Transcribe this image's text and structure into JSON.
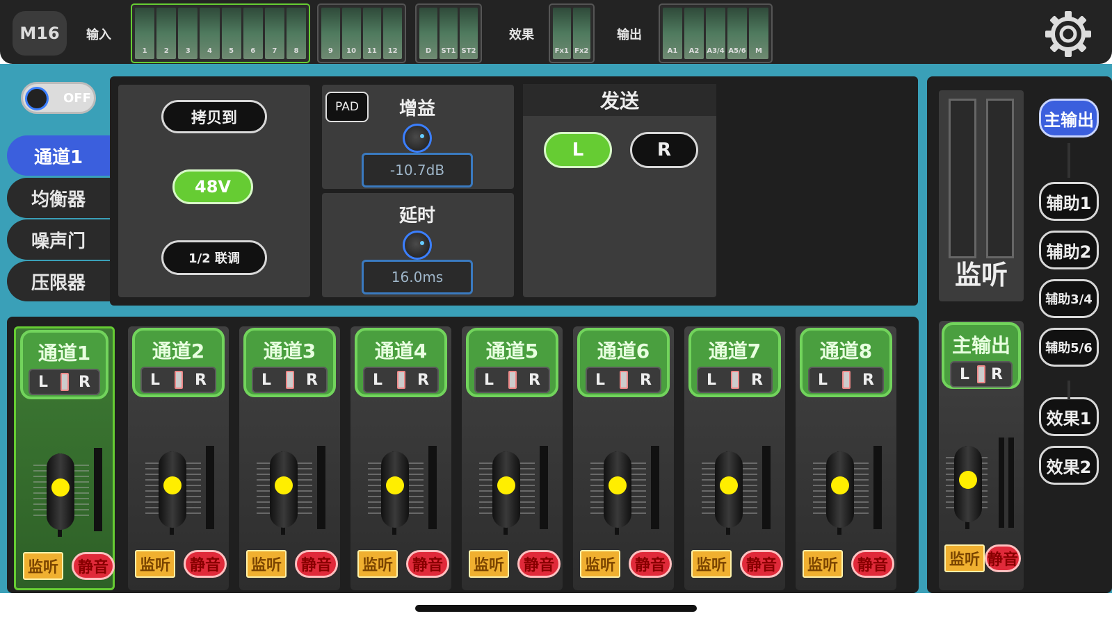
{
  "app": {
    "logo": "M16"
  },
  "topbar": {
    "input_label": "输入",
    "fx_label": "效果",
    "output_label": "输出",
    "input_meters_1": [
      "1",
      "2",
      "3",
      "4",
      "5",
      "6",
      "7",
      "8"
    ],
    "input_meters_2": [
      "9",
      "10",
      "11",
      "12"
    ],
    "input_meters_3": [
      "D",
      "ST1",
      "ST2"
    ],
    "fx_meters": [
      "Fx1",
      "Fx2"
    ],
    "output_meters": [
      "A1",
      "A2",
      "A3/4",
      "A5/6",
      "M"
    ]
  },
  "power_toggle": {
    "label": "OFF"
  },
  "side_tabs": [
    {
      "label": "通道1",
      "active": true
    },
    {
      "label": "均衡器",
      "active": false
    },
    {
      "label": "噪声门",
      "active": false
    },
    {
      "label": "压限器",
      "active": false
    }
  ],
  "channel_panel": {
    "copy_button": "拷贝到",
    "phantom_button": "48V",
    "stereo_button": "1/2 联调",
    "pad_button": "PAD",
    "gain_label": "增益",
    "gain_value": "-10.7dB",
    "delay_label": "延时",
    "delay_value": "16.0ms",
    "send_title": "发送",
    "send_l": "L",
    "send_r": "R"
  },
  "strips": [
    {
      "name": "通道1",
      "L": "L",
      "R": "R",
      "monitor": "监听",
      "mute": "静音",
      "selected": true
    },
    {
      "name": "通道2",
      "L": "L",
      "R": "R",
      "monitor": "监听",
      "mute": "静音",
      "selected": false
    },
    {
      "name": "通道3",
      "L": "L",
      "R": "R",
      "monitor": "监听",
      "mute": "静音",
      "selected": false
    },
    {
      "name": "通道4",
      "L": "L",
      "R": "R",
      "monitor": "监听",
      "mute": "静音",
      "selected": false
    },
    {
      "name": "通道5",
      "L": "L",
      "R": "R",
      "monitor": "监听",
      "mute": "静音",
      "selected": false
    },
    {
      "name": "通道6",
      "L": "L",
      "R": "R",
      "monitor": "监听",
      "mute": "静音",
      "selected": false
    },
    {
      "name": "通道7",
      "L": "L",
      "R": "R",
      "monitor": "监听",
      "mute": "静音",
      "selected": false
    },
    {
      "name": "通道8",
      "L": "L",
      "R": "R",
      "monitor": "监听",
      "mute": "静音",
      "selected": false
    }
  ],
  "master": {
    "monitor_label": "监听",
    "name": "主输出",
    "L": "L",
    "R": "R",
    "monitor": "监听",
    "mute": "静音"
  },
  "buses": [
    {
      "label": "主输出",
      "active": true
    },
    {
      "label": "辅助1",
      "active": false
    },
    {
      "label": "辅助2",
      "active": false
    },
    {
      "label": "辅助3/4",
      "active": false
    },
    {
      "label": "辅助5/6",
      "active": false
    },
    {
      "label": "效果1",
      "active": false
    },
    {
      "label": "效果2",
      "active": false
    }
  ],
  "colors": {
    "accent_green": "#66cc33",
    "accent_blue": "#3b5fdd",
    "mute_red": "#e02a3a",
    "monitor_yellow": "#f0b030",
    "frame_teal": "#3aa0b8"
  },
  "icons": {
    "settings": "gear-icon"
  }
}
